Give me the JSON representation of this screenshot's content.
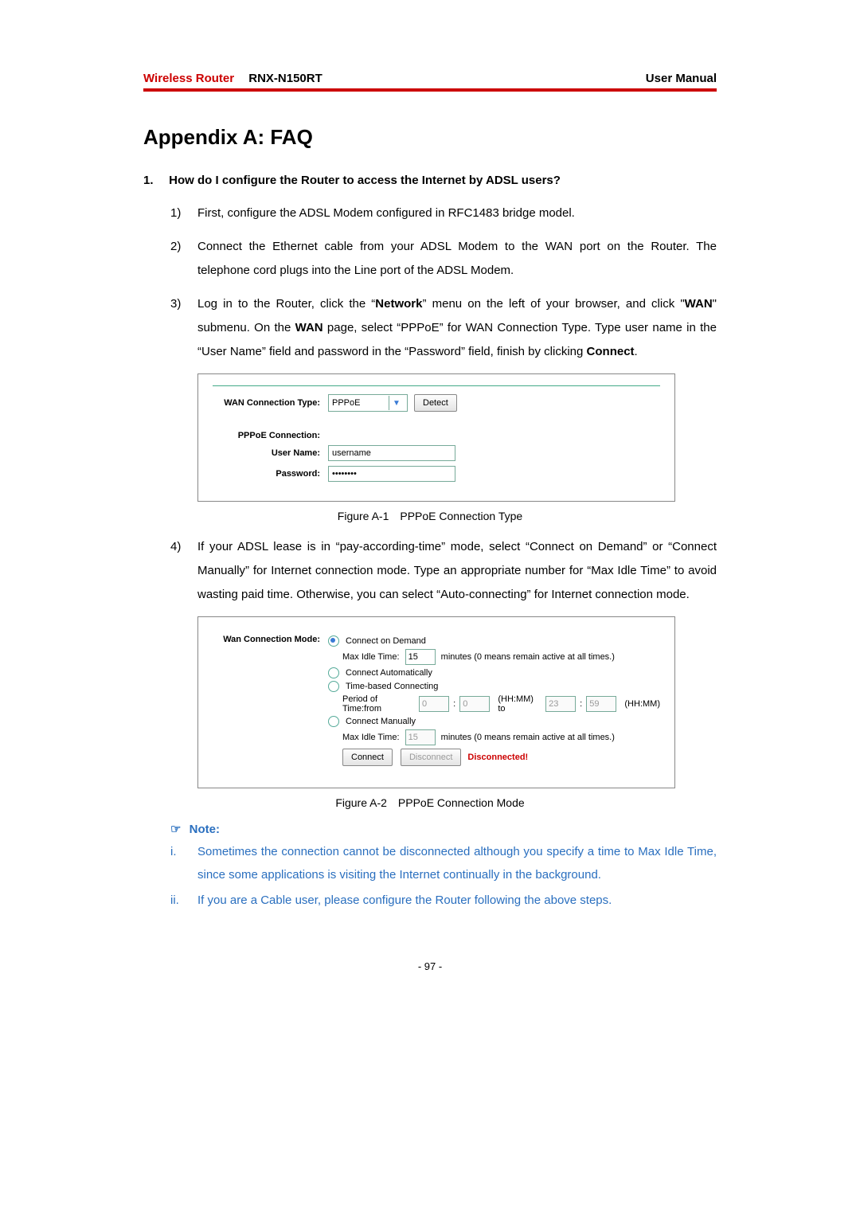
{
  "header": {
    "brand": "Wireless Router",
    "model": "RNX-N150RT",
    "right": "User Manual"
  },
  "title": "Appendix A: FAQ",
  "question": {
    "num": "1.",
    "text": "How do I configure the Router to access the Internet by ADSL users?"
  },
  "steps": {
    "s1": {
      "mark": "1)",
      "text": "First, configure the ADSL Modem configured in RFC1483 bridge model."
    },
    "s2": {
      "mark": "2)",
      "text": "Connect the Ethernet cable from your ADSL Modem to the WAN port on the Router. The telephone cord plugs into the Line port of the ADSL Modem."
    },
    "s3": {
      "mark": "3)",
      "pre": "Log in to the Router, click the “",
      "b1": "Network",
      "mid1": "” menu on the left of your browser, and click \"",
      "b2": "WAN",
      "mid2": "\" submenu. On the ",
      "b3": "WAN",
      "mid3": " page, select “PPPoE” for WAN Connection Type. Type user name in the “User Name” field and password in the “Password” field, finish by clicking ",
      "b4": "Connect",
      "post": "."
    },
    "s4": {
      "mark": "4)",
      "text": "If your ADSL lease is in “pay-according-time” mode, select “Connect on Demand” or “Connect Manually” for Internet connection mode. Type an appropriate number for “Max Idle Time” to avoid wasting paid time. Otherwise, you can select “Auto-connecting” for Internet connection mode."
    }
  },
  "fig1": {
    "wan_label": "WAN Connection Type:",
    "wan_value": "PPPoE",
    "detect": "Detect",
    "pppoe_label": "PPPoE Connection:",
    "user_label": "User Name:",
    "user_value": "username",
    "pass_label": "Password:",
    "pass_value": "••••••••",
    "caption": "Figure A-1 PPPoE Connection Type"
  },
  "fig2": {
    "mode_label": "Wan Connection Mode:",
    "r1": "Connect on Demand",
    "idle_label": "Max Idle Time:",
    "idle_val": "15",
    "idle_tail": "minutes (0 means remain active at all times.)",
    "r2": "Connect Automatically",
    "r3": "Time-based Connecting",
    "period_label": "Period of Time:from",
    "p_from_h": "0",
    "p_from_m": "0",
    "hhmm_to": "(HH:MM) to",
    "p_to_h": "23",
    "p_to_m": "59",
    "hhmm": "(HH:MM)",
    "r4": "Connect Manually",
    "idle2_val": "15",
    "connect": "Connect",
    "disconnect": "Disconnect",
    "status": "Disconnected!",
    "caption": "Figure A-2 PPPoE Connection Mode"
  },
  "note": {
    "head": "Note:",
    "i1_mark": "i.",
    "i1": "Sometimes the connection cannot be disconnected although you specify a time to Max Idle Time, since some applications is visiting the Internet continually in the background.",
    "i2_mark": "ii.",
    "i2": "If you are a Cable user, please configure the Router following the above steps."
  },
  "footer": "- 97 -"
}
